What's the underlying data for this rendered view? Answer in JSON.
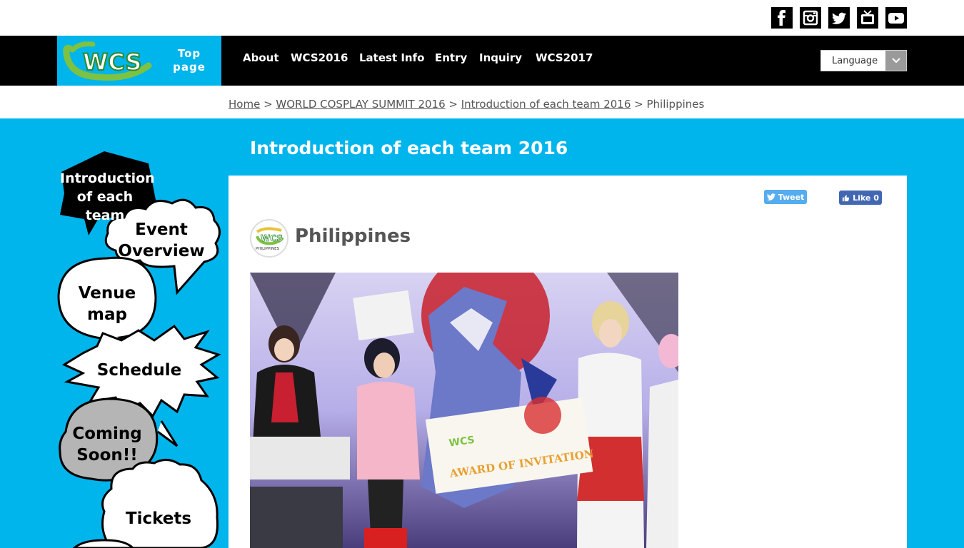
{
  "social": {
    "facebook": "facebook-icon",
    "instagram": "instagram-icon",
    "twitter": "twitter-icon",
    "tv": "tv-icon",
    "youtube": "youtube-icon"
  },
  "header": {
    "logo_text": "WCS",
    "top_page_line1": "Top",
    "top_page_line2": "page",
    "nav": [
      "About",
      "WCS2016",
      "Latest Info",
      "Entry",
      "Inquiry",
      "WCS2017"
    ],
    "language_label": "Language"
  },
  "breadcrumb": {
    "home": "Home",
    "sep1": " > ",
    "summit": "WORLD COSPLAY SUMMIT 2016",
    "sep2": " > ",
    "intro": "Introduction of each team 2016",
    "sep3": " > ",
    "current": "Philippines"
  },
  "section": {
    "title": "Introduction of each team 2016"
  },
  "share": {
    "tweet": "Tweet",
    "like": "Like 0"
  },
  "team": {
    "name": "Philippines",
    "badge_text": "WCS",
    "badge_sub": "PHILIPPINES"
  },
  "photo": {
    "banner_logo": "WCS",
    "banner_text": "AWARD OF INVITATION"
  },
  "sidebar": {
    "items": [
      {
        "line1": "Introduction",
        "line2": "of each team"
      },
      {
        "line1": "Event",
        "line2": "Overview"
      },
      {
        "line1": "Venue",
        "line2": "map"
      },
      {
        "line1": "Schedule",
        "line2": ""
      },
      {
        "line1": "Coming",
        "line2": "Soon!!"
      },
      {
        "line1": "Tickets",
        "line2": ""
      }
    ]
  },
  "colors": {
    "brand_blue": "#00b4ec",
    "nav_black": "#000000",
    "tweet_blue": "#55acee",
    "facebook_blue": "#4267b2"
  }
}
